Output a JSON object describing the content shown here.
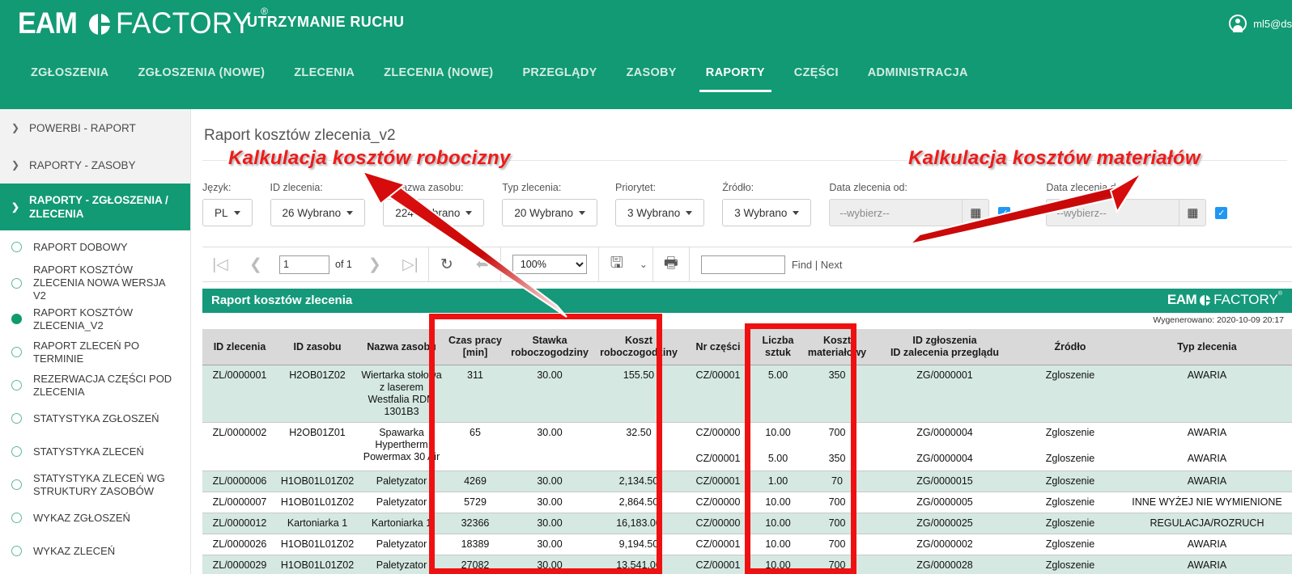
{
  "header": {
    "brand_eam": "EAM",
    "brand_factory": "FACTORY",
    "brand_reg": "®",
    "app_title": "UTRZYMANIE RUCHU",
    "user": "ml5@ds",
    "nav": [
      {
        "label": "ZGŁOSZENIA",
        "active": false
      },
      {
        "label": "ZGŁOSZENIA (NOWE)",
        "active": false
      },
      {
        "label": "ZLECENIA",
        "active": false
      },
      {
        "label": "ZLECENIA (NOWE)",
        "active": false
      },
      {
        "label": "PRZEGLĄDY",
        "active": false
      },
      {
        "label": "ZASOBY",
        "active": false
      },
      {
        "label": "RAPORTY",
        "active": true
      },
      {
        "label": "CZĘŚCI",
        "active": false
      },
      {
        "label": "ADMINISTRACJA",
        "active": false
      }
    ]
  },
  "sidebar": {
    "groups": [
      {
        "label": "POWERBI - RAPORT",
        "active": false
      },
      {
        "label": "RAPORTY - ZASOBY",
        "active": false
      },
      {
        "label": "RAPORTY - ZGŁOSZENIA / ZLECENIA",
        "active": true
      }
    ],
    "items": [
      {
        "label": "RAPORT DOBOWY",
        "selected": false
      },
      {
        "label": "RAPORT KOSZTÓW ZLECENIA NOWA WERSJA V2",
        "selected": false
      },
      {
        "label": "RAPORT KOSZTÓW ZLECENIA_V2",
        "selected": true
      },
      {
        "label": "RAPORT ZLECEŃ PO TERMINIE",
        "selected": false
      },
      {
        "label": "REZERWACJA CZĘŚCI POD ZLECENIA",
        "selected": false
      },
      {
        "label": "STATYSTYKA ZGŁOSZEŃ",
        "selected": false
      },
      {
        "label": "STATYSTYKA ZLECEŃ",
        "selected": false
      },
      {
        "label": "STATYSTYKA ZLECEŃ WG STRUKTURY ZASOBÓW",
        "selected": false
      },
      {
        "label": "WYKAZ ZGŁOSZEŃ",
        "selected": false
      },
      {
        "label": "WYKAZ ZLECEŃ",
        "selected": false
      }
    ]
  },
  "page": {
    "title": "Raport kosztów zlecenia_v2"
  },
  "filters": [
    {
      "label": "Język:",
      "value": "PL"
    },
    {
      "label": "ID zlecenia:",
      "value": "26 Wybrano"
    },
    {
      "label": "ID nazwa zasobu:",
      "value": "224 Wybrano"
    },
    {
      "label": "Typ zlecenia:",
      "value": "20 Wybrano"
    },
    {
      "label": "Priorytet:",
      "value": "3 Wybrano"
    },
    {
      "label": "Źródło:",
      "value": "3 Wybrano"
    }
  ],
  "date_filters": [
    {
      "label": "Data zlecenia od:",
      "placeholder": "--wybierz--",
      "checked": true
    },
    {
      "label": "Data zlecenia do:",
      "placeholder": "--wybierz--",
      "checked": true
    }
  ],
  "toolbar": {
    "first_icon": "first-page-icon",
    "prev_icon": "previous-page-icon",
    "page_value": "1",
    "of_label": "of 1",
    "next_icon": "next-page-icon",
    "last_icon": "last-page-icon",
    "refresh_icon": "refresh-icon",
    "back_icon": "back-to-parent-icon",
    "zoom_value": "100%",
    "zoom_options": [
      "100%"
    ],
    "export_icon": "save-export-icon",
    "print_icon": "print-icon",
    "find_value": "",
    "find_label": "Find | Next"
  },
  "report": {
    "title": "Raport kosztów zlecenia",
    "logo_eam": "EAM",
    "logo_factory": "FACTORY",
    "generated": "Wygenerowano: 2020-10-09 20:17",
    "columns": [
      "ID zlecenia",
      "ID zasobu",
      "Nazwa zasobu",
      "Czas pracy\n[min]",
      "Stawka\nroboczogodziny",
      "Koszt\nroboczogodziny",
      "Nr części",
      "Liczba\nsztuk",
      "Koszt\nmateriałowy",
      "ID zgłoszenia\nID zalecenia przeglądu",
      "Źródło",
      "Typ zlecenia"
    ],
    "rows": [
      {
        "zlecenie": "ZL/0000001",
        "zasob_id": "H2OB01Z02",
        "zasob_nazwa": "Wiertarka stołowa z laserem Westfalia RDM 1301B3",
        "czas": "311",
        "stawka": "30.00",
        "koszt_rbh": "155.50",
        "czesci": [
          "CZ/00001"
        ],
        "sztuk": [
          "5.00"
        ],
        "koszt_mat": [
          "350"
        ],
        "zgloszenie": [
          "ZG/0000001"
        ],
        "zrodlo": [
          "Zgloszenie"
        ],
        "typ": [
          "AWARIA"
        ],
        "alt": true,
        "tall": true
      },
      {
        "zlecenie": "ZL/0000002",
        "zasob_id": "H2OB01Z01",
        "zasob_nazwa": "Spawarka Hypertherm Powermax 30 Air",
        "czas": "65",
        "stawka": "30.00",
        "koszt_rbh": "32.50",
        "czesci": [
          "CZ/00000",
          "CZ/00001"
        ],
        "sztuk": [
          "10.00",
          "5.00"
        ],
        "koszt_mat": [
          "700",
          "350"
        ],
        "zgloszenie": [
          "ZG/0000004",
          "ZG/0000004"
        ],
        "zrodlo": [
          "Zgloszenie",
          "Zgloszenie"
        ],
        "typ": [
          "AWARIA",
          "AWARIA"
        ],
        "alt": false,
        "tall": true
      },
      {
        "zlecenie": "ZL/0000006",
        "zasob_id": "H1OB01L01Z02",
        "zasob_nazwa": "Paletyzator",
        "czas": "4269",
        "stawka": "30.00",
        "koszt_rbh": "2,134.50",
        "czesci": [
          "CZ/00001"
        ],
        "sztuk": [
          "1.00"
        ],
        "koszt_mat": [
          "70"
        ],
        "zgloszenie": [
          "ZG/0000015"
        ],
        "zrodlo": [
          "Zgloszenie"
        ],
        "typ": [
          "AWARIA"
        ],
        "alt": true,
        "tall": false
      },
      {
        "zlecenie": "ZL/0000007",
        "zasob_id": "H1OB01L01Z02",
        "zasob_nazwa": "Paletyzator",
        "czas": "5729",
        "stawka": "30.00",
        "koszt_rbh": "2,864.50",
        "czesci": [
          "CZ/00000"
        ],
        "sztuk": [
          "10.00"
        ],
        "koszt_mat": [
          "700"
        ],
        "zgloszenie": [
          "ZG/0000005"
        ],
        "zrodlo": [
          "Zgloszenie"
        ],
        "typ": [
          "INNE WYŻEJ NIE WYMIENIONE"
        ],
        "alt": false,
        "tall": false
      },
      {
        "zlecenie": "ZL/0000012",
        "zasob_id": "Kartoniarka 1",
        "zasob_nazwa": "Kartoniarka 1",
        "czas": "32366",
        "stawka": "30.00",
        "koszt_rbh": "16,183.00",
        "czesci": [
          "CZ/00000"
        ],
        "sztuk": [
          "10.00"
        ],
        "koszt_mat": [
          "700"
        ],
        "zgloszenie": [
          "ZG/0000025"
        ],
        "zrodlo": [
          "Zgloszenie"
        ],
        "typ": [
          "REGULACJA/ROZRUCH"
        ],
        "alt": true,
        "tall": false
      },
      {
        "zlecenie": "ZL/0000026",
        "zasob_id": "H1OB01L01Z02",
        "zasob_nazwa": "Paletyzator",
        "czas": "18389",
        "stawka": "30.00",
        "koszt_rbh": "9,194.50",
        "czesci": [
          "CZ/00001"
        ],
        "sztuk": [
          "10.00"
        ],
        "koszt_mat": [
          "700"
        ],
        "zgloszenie": [
          "ZG/0000002"
        ],
        "zrodlo": [
          "Zgloszenie"
        ],
        "typ": [
          "AWARIA"
        ],
        "alt": false,
        "tall": false
      },
      {
        "zlecenie": "ZL/0000029",
        "zasob_id": "H1OB01L01Z02",
        "zasob_nazwa": "Paletyzator",
        "czas": "27082",
        "stawka": "30.00",
        "koszt_rbh": "13,541.00",
        "czesci": [
          "CZ/00001"
        ],
        "sztuk": [
          "10.00"
        ],
        "koszt_mat": [
          "700"
        ],
        "zgloszenie": [
          "ZG/0000028"
        ],
        "zrodlo": [
          "Zgloszenie"
        ],
        "typ": [
          "AWARIA"
        ],
        "alt": true,
        "tall": false
      }
    ]
  },
  "annotations": {
    "labor": "Kalkulacja kosztów robocizny",
    "material": "Kalkulacja kosztów materiałów",
    "highlight_color": "#ef1111"
  }
}
